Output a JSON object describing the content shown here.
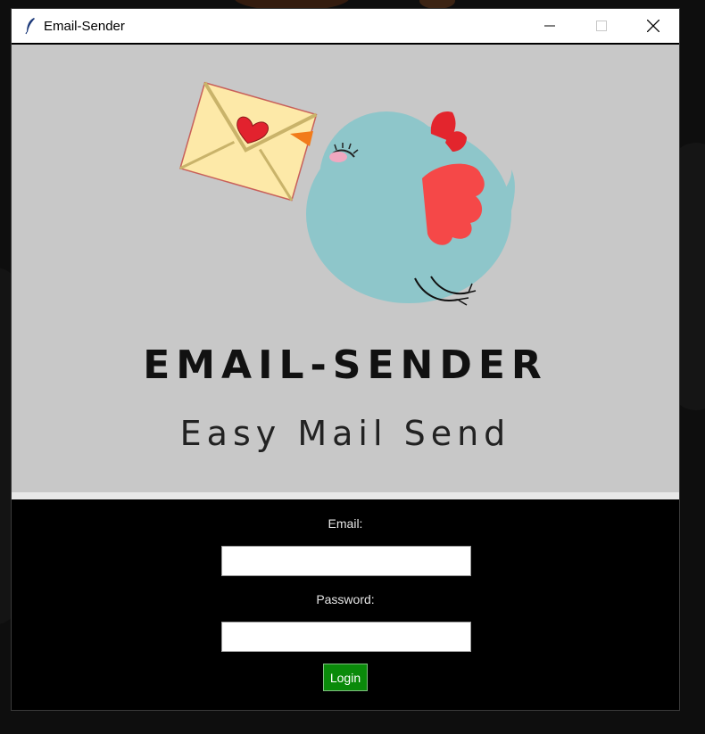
{
  "window": {
    "title": "Email-Sender",
    "icon": "feather-icon",
    "controls": [
      "minimize-icon",
      "maximize-icon",
      "close-icon"
    ]
  },
  "banner": {
    "title": "EMAIL-SENDER",
    "subtitle": "Easy Mail Send",
    "background_color": "#c8c8c8"
  },
  "form": {
    "email_label": "Email:",
    "email_value": "",
    "password_label": "Password:",
    "password_value": "",
    "login_label": "Login",
    "login_color": "#0a8a0a"
  }
}
